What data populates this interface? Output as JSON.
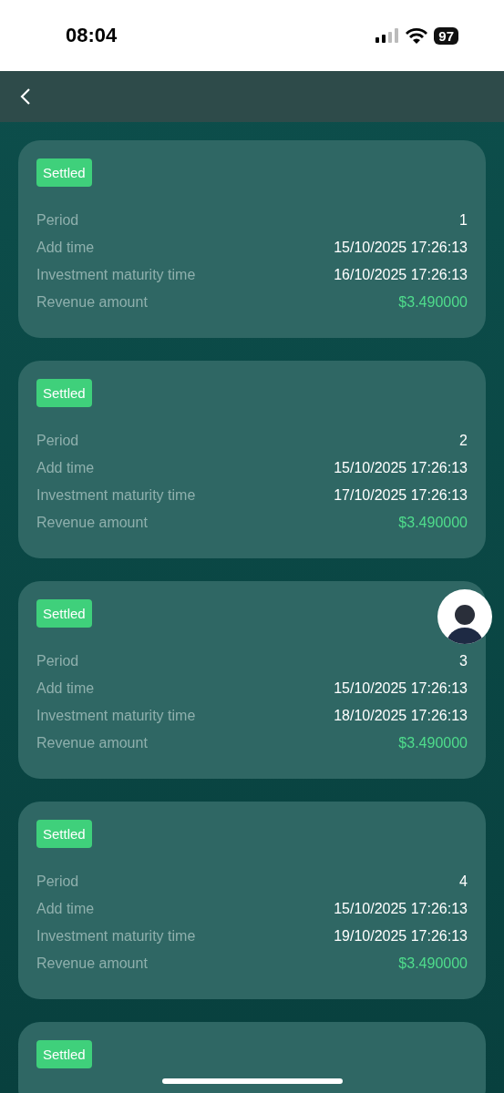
{
  "status_bar": {
    "time": "08:04",
    "battery": "97"
  },
  "orders": [
    {
      "status": "Settled",
      "rows": [
        {
          "label": "Period",
          "value": "1",
          "kind": "plain"
        },
        {
          "label": "Add time",
          "value": "15/10/2025 17:26:13",
          "kind": "plain"
        },
        {
          "label": "Investment maturity time",
          "value": "16/10/2025 17:26:13",
          "kind": "plain"
        },
        {
          "label": "Revenue amount",
          "value": "$3.490000",
          "kind": "amount"
        }
      ]
    },
    {
      "status": "Settled",
      "rows": [
        {
          "label": "Period",
          "value": "2",
          "kind": "plain"
        },
        {
          "label": "Add time",
          "value": "15/10/2025 17:26:13",
          "kind": "plain"
        },
        {
          "label": "Investment maturity time",
          "value": "17/10/2025 17:26:13",
          "kind": "plain"
        },
        {
          "label": "Revenue amount",
          "value": "$3.490000",
          "kind": "amount"
        }
      ]
    },
    {
      "status": "Settled",
      "rows": [
        {
          "label": "Period",
          "value": "3",
          "kind": "plain"
        },
        {
          "label": "Add time",
          "value": "15/10/2025 17:26:13",
          "kind": "plain"
        },
        {
          "label": "Investment maturity time",
          "value": "18/10/2025 17:26:13",
          "kind": "plain"
        },
        {
          "label": "Revenue amount",
          "value": "$3.490000",
          "kind": "amount"
        }
      ]
    },
    {
      "status": "Settled",
      "rows": [
        {
          "label": "Period",
          "value": "4",
          "kind": "plain"
        },
        {
          "label": "Add time",
          "value": "15/10/2025 17:26:13",
          "kind": "plain"
        },
        {
          "label": "Investment maturity time",
          "value": "19/10/2025 17:26:13",
          "kind": "plain"
        },
        {
          "label": "Revenue amount",
          "value": "$3.490000",
          "kind": "amount"
        }
      ]
    },
    {
      "status": "Settled"
    }
  ]
}
